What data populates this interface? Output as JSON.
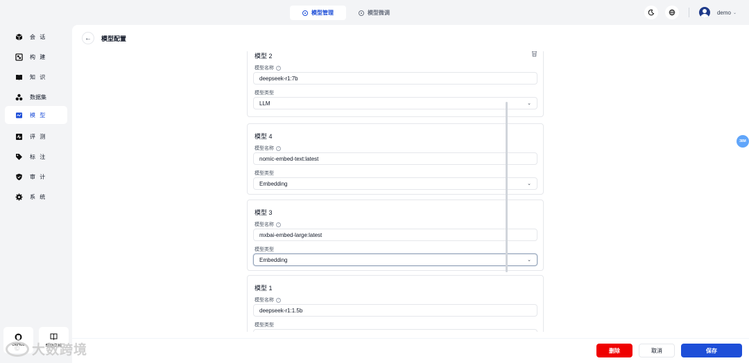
{
  "topbar": {
    "tabs": [
      {
        "label": "模型管理",
        "active": true
      },
      {
        "label": "模型微调",
        "active": false
      }
    ],
    "user": "demo"
  },
  "sidebar": {
    "items": [
      {
        "label": "会 话",
        "icon": "cube-icon"
      },
      {
        "label": "构 建",
        "icon": "build-icon"
      },
      {
        "label": "知 识",
        "icon": "book-icon"
      },
      {
        "label": "数据集",
        "icon": "dataset-icon"
      },
      {
        "label": "模 型",
        "icon": "model-icon",
        "active": true
      },
      {
        "label": "评 测",
        "icon": "evaluate-icon"
      },
      {
        "label": "标 注",
        "icon": "tag-icon"
      },
      {
        "label": "审 计",
        "icon": "shield-icon"
      },
      {
        "label": "系 统",
        "icon": "gear-icon"
      }
    ],
    "bottom": [
      {
        "label": "GitHub",
        "icon": "github-icon"
      },
      {
        "label": "帮助文档",
        "icon": "docs-icon"
      }
    ]
  },
  "page": {
    "title": "模型配置"
  },
  "models": [
    {
      "title": "模型 2",
      "name_label": "模型名称",
      "name": "deepseek-r1:7b",
      "type_label": "模型类型",
      "type": "LLM"
    },
    {
      "title": "模型 4",
      "name_label": "模型名称",
      "name": "nomic-embed-text:latest",
      "type_label": "模型类型",
      "type": "Embedding"
    },
    {
      "title": "模型 3",
      "name_label": "模型名称",
      "name": "mxbai-embed-large:latest",
      "type_label": "模型类型",
      "type": "Embedding"
    },
    {
      "title": "模型 1",
      "name_label": "模型名称",
      "name": "deepseek-r1:1.5b",
      "type_label": "模型类型",
      "type": ""
    }
  ],
  "footer": {
    "delete": "删除",
    "cancel": "取消",
    "save": "保存"
  },
  "float_badge": "38M",
  "watermark": "大数跨境",
  "colors": {
    "primary": "#1d4ed8",
    "danger": "#ef0000",
    "badge": "#60a5fa"
  }
}
